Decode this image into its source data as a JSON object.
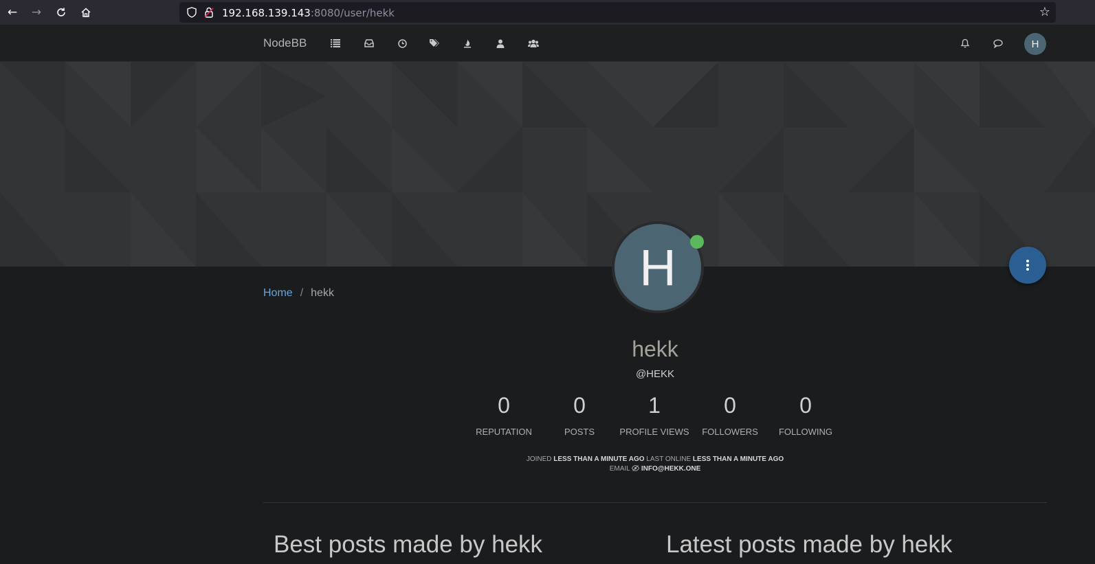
{
  "browser": {
    "url_host": "192.168.139.143",
    "url_path": ":8080/user/hekk"
  },
  "header": {
    "brand": "NodeBB",
    "nav_icons": [
      "categories-icon",
      "unread-icon",
      "recent-icon",
      "tags-icon",
      "popular-icon",
      "users-icon",
      "groups-icon"
    ],
    "avatar_letter": "H"
  },
  "profile": {
    "avatar_letter": "H",
    "status": "online",
    "fullname": "hekk",
    "username": "@HEKK",
    "stats": [
      {
        "value": "0",
        "label": "REPUTATION"
      },
      {
        "value": "0",
        "label": "POSTS"
      },
      {
        "value": "1",
        "label": "PROFILE VIEWS"
      },
      {
        "value": "0",
        "label": "FOLLOWERS"
      },
      {
        "value": "0",
        "label": "FOLLOWING"
      }
    ],
    "joined_label": "JOINED",
    "joined_value": "LESS THAN A MINUTE AGO",
    "last_online_label": "LAST ONLINE",
    "last_online_value": "LESS THAN A MINUTE AGO",
    "email_label": "EMAIL",
    "email_value": "INFO@HEKK.ONE"
  },
  "breadcrumb": {
    "home": "Home",
    "separator": "/",
    "current": "hekk"
  },
  "sections": {
    "best_posts": "Best posts made by hekk",
    "latest_posts": "Latest posts made by hekk"
  },
  "colors": {
    "accent": "#6ba6db",
    "fab": "#2b5e93",
    "avatar": "#4c6572",
    "online": "#5cb85c"
  }
}
